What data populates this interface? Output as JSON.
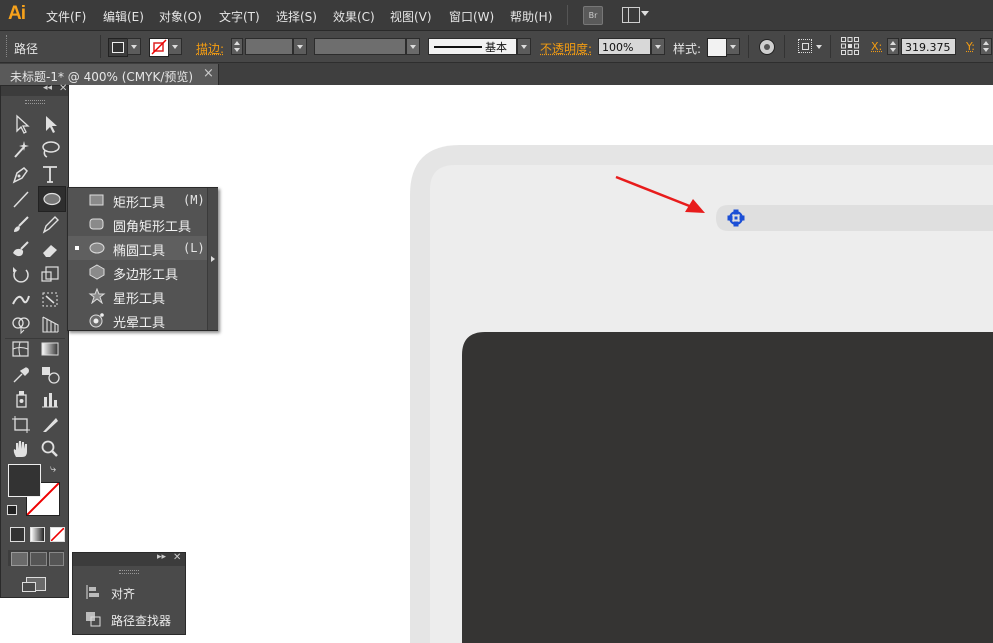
{
  "app": {
    "logo": "Ai"
  },
  "menubar": {
    "items": [
      "文件(F)",
      "编辑(E)",
      "对象(O)",
      "文字(T)",
      "选择(S)",
      "效果(C)",
      "视图(V)",
      "窗口(W)",
      "帮助(H)"
    ],
    "bridge_label": "Br"
  },
  "controlbar": {
    "selection_type": "路径",
    "stroke_label": "描边:",
    "stroke_style_label": "基本",
    "opacity_label": "不透明度:",
    "opacity_value": "100%",
    "style_label": "样式:",
    "x_label": "X:",
    "x_value": "319.375",
    "y_label": "Y:"
  },
  "document_tab": {
    "title": "未标题-1* @ 400% (CMYK/预览)",
    "close": "×"
  },
  "flyout": {
    "items": [
      {
        "label": "矩形工具",
        "shortcut": "(M)",
        "icon": "rectangle-icon"
      },
      {
        "label": "圆角矩形工具",
        "shortcut": "",
        "icon": "rounded-rectangle-icon"
      },
      {
        "label": "椭圆工具",
        "shortcut": "(L)",
        "icon": "ellipse-icon",
        "selected": true
      },
      {
        "label": "多边形工具",
        "shortcut": "",
        "icon": "polygon-icon"
      },
      {
        "label": "星形工具",
        "shortcut": "",
        "icon": "star-icon"
      },
      {
        "label": "光晕工具",
        "shortcut": "",
        "icon": "flare-icon"
      }
    ]
  },
  "align_panel": {
    "items": [
      "对齐",
      "路径查找器"
    ]
  },
  "colors": {
    "accent_orange": "#f39c12",
    "selection_blue": "#1c4fd6",
    "arrow_red": "#e81c1c",
    "device_frame": "#e5e5e5",
    "device_screen": "#353433"
  }
}
